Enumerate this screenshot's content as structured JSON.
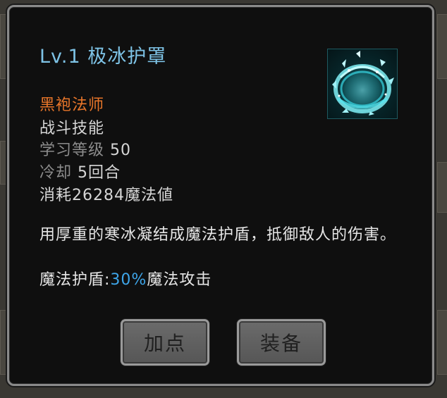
{
  "skill": {
    "title": "Lv.1 极冰护罩",
    "icon": "ice-shield-icon",
    "class": "黑袍法师",
    "type": "战斗技能",
    "learn_level_label": "学习等级",
    "learn_level_value": "50",
    "cooldown_label": "冷却",
    "cooldown_value": "5回合",
    "cost": "消耗26284魔法値",
    "description": "用厚重的寒冰凝结成魔法护盾，抵御敌人的伤害。",
    "effect_prefix": "魔法护盾:",
    "effect_value": "30%",
    "effect_suffix": "魔法攻击"
  },
  "buttons": {
    "add_point": "加点",
    "equip": "装备"
  },
  "colors": {
    "title": "#7ec3e6",
    "class": "#e8762a",
    "highlight": "#3ea6ea",
    "panel_bg": "#0f0f0f",
    "panel_border": "#8a8a8a"
  }
}
